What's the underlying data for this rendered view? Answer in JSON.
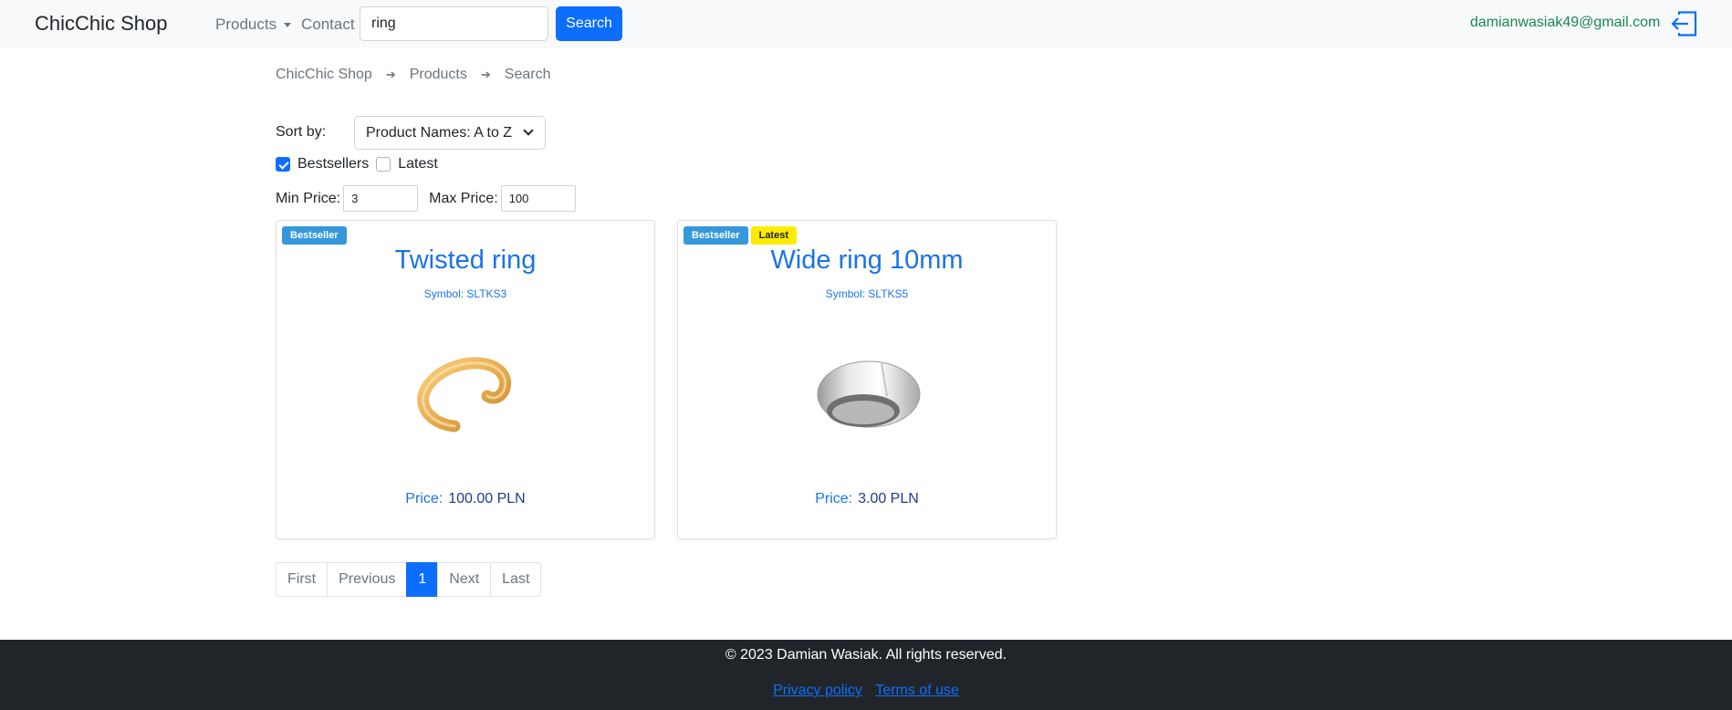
{
  "navbar": {
    "brand": "ChicChic Shop",
    "products_label": "Products",
    "contact_label": "Contact",
    "search_value": "ring",
    "search_button": "Search",
    "user_email": "damianwasiak49@gmail.com"
  },
  "breadcrumb": [
    "ChicChic Shop",
    "Products",
    "Search"
  ],
  "filters": {
    "sort_label": "Sort by:",
    "sort_selected": "Product Names: A to Z",
    "bestsellers_label": "Bestsellers",
    "bestsellers_checked": true,
    "latest_label": "Latest",
    "latest_checked": false,
    "min_price_label": "Min Price:",
    "min_price_value": "3",
    "max_price_label": "Max Price:",
    "max_price_value": "100"
  },
  "products": [
    {
      "badges": [
        "Bestseller"
      ],
      "title": "Twisted ring",
      "symbol": "Symbol: SLTKS3",
      "price_label": "Price:",
      "price_value": "100.00 PLN",
      "image": "gold-twisted-ring"
    },
    {
      "badges": [
        "Bestseller",
        "Latest"
      ],
      "title": "Wide ring 10mm",
      "symbol": "Symbol: SLTKS5",
      "price_label": "Price:",
      "price_value": "3.00 PLN",
      "image": "silver-wide-ring"
    }
  ],
  "pagination": {
    "first": "First",
    "previous": "Previous",
    "current": "1",
    "next": "Next",
    "last": "Last"
  },
  "footer": {
    "copyright": "© 2023 Damian Wasiak. All rights reserved.",
    "privacy": "Privacy policy",
    "terms": "Terms of use"
  },
  "colors": {
    "primary": "#0d6efd",
    "bestseller_badge": "#3498db",
    "latest_badge": "#ffeb00",
    "email": "#198754",
    "footer_bg": "#212529"
  },
  "icons": {
    "logout": "logout-icon",
    "dropdown": "caret-down-icon",
    "breadcrumb_separator": "arrow-right-icon"
  }
}
